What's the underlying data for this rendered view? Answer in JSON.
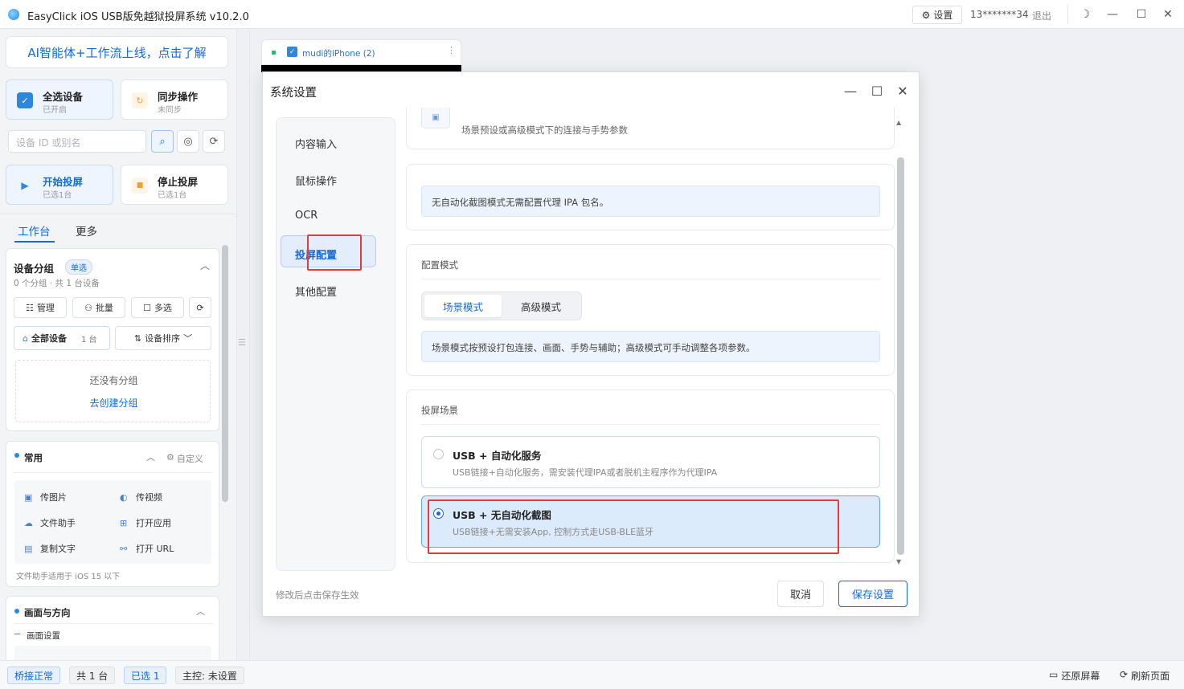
{
  "app": {
    "title": "EasyClick iOS USB版免越狱投屏系统 v10.2.0",
    "settings_label": "设置",
    "user_id": "13*******34",
    "logout_label": "退出"
  },
  "left": {
    "ai_banner": "AI智能体+工作流上线，点击了解",
    "select_all": {
      "title": "全选设备",
      "sub": "已开启"
    },
    "sync": {
      "title": "同步操作",
      "sub": "未同步"
    },
    "search_placeholder": "设备 ID 或别名",
    "start_cast": {
      "title": "开始投屏",
      "sub": "已选1台"
    },
    "stop_cast": {
      "title": "停止投屏",
      "sub": "已选1台"
    },
    "tabs": [
      "工作台",
      "更多"
    ],
    "device_group": {
      "title": "设备分组",
      "badge": "单选",
      "summary": "0 个分组 · 共 1 台设备",
      "manage": "管理",
      "batch": "批量",
      "multi": "多选",
      "all_devices": "全部设备",
      "all_count": "1 台",
      "sort": "设备排序",
      "empty_text": "还没有分组",
      "create_link": "去创建分组"
    },
    "common": {
      "title": "常用",
      "customize": "自定义",
      "items": [
        "传图片",
        "传视频",
        "文件助手",
        "打开应用",
        "复制文字",
        "打开 URL"
      ],
      "note": "文件助手适用于 iOS 15 以下"
    },
    "display": {
      "title": "画面与方向",
      "sub": "画面设置"
    }
  },
  "phone": {
    "name": "mudi的iPhone (2)"
  },
  "dialog": {
    "title": "系统设置",
    "nav": [
      "内容输入",
      "鼠标操作",
      "OCR",
      "投屏配置",
      "其他配置"
    ],
    "top_hint": "场景预设或高级模式下的连接与手势参数",
    "ipa_hint": "无自动化截图模式无需配置代理 IPA 包名。",
    "config_mode": {
      "label": "配置模式",
      "scene": "场景模式",
      "advanced": "高级模式",
      "hint": "场景模式按预设打包连接、画面、手势与辅助；高级模式可手动调整各项参数。"
    },
    "cast_scene": {
      "label": "投屏场景",
      "options": [
        {
          "title": "USB + 自动化服务",
          "desc": "USB链接+自动化服务，需安装代理IPA或者脱机主程序作为代理IPA"
        },
        {
          "title": "USB + 无自动化截图",
          "desc": "USB链接+无需安装App, 控制方式走USB-BLE蓝牙"
        }
      ]
    },
    "footer_note": "修改后点击保存生效",
    "cancel": "取消",
    "save": "保存设置"
  },
  "status": {
    "bridge": "桥接正常",
    "total": "共 1 台",
    "selected": "已选 1",
    "master": "主控: 未设置",
    "restore": "还原屏幕",
    "refresh": "刷新页面"
  }
}
